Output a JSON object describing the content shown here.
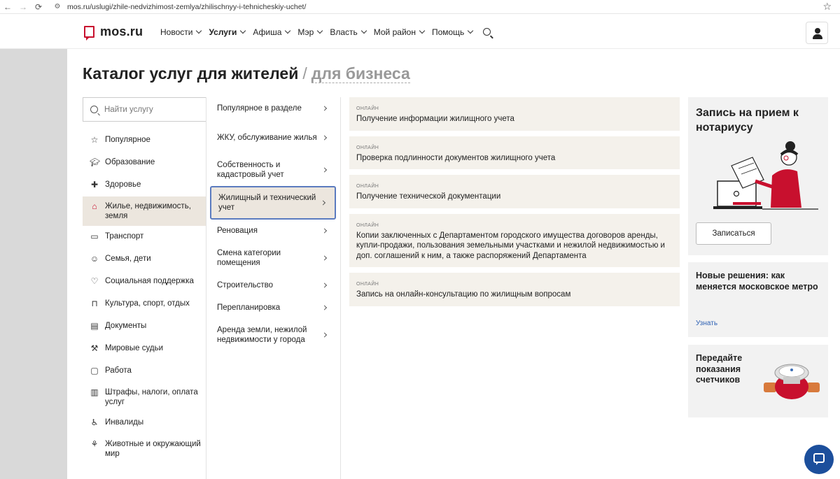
{
  "browser": {
    "back": "←",
    "forward": "→",
    "reload": "C",
    "url": "mos.ru/uslugi/zhile-nedvizhimost-zemlya/zhilischnyy-i-tehnicheskiy-uchet/"
  },
  "header": {
    "logo": "mos.ru",
    "menu": [
      {
        "label": "Новости",
        "active": false
      },
      {
        "label": "Услуги",
        "active": true
      },
      {
        "label": "Афиша",
        "active": false
      },
      {
        "label": "Мэр",
        "active": false
      },
      {
        "label": "Власть",
        "active": false
      },
      {
        "label": "Мой район",
        "active": false
      },
      {
        "label": "Помощь",
        "active": false
      }
    ]
  },
  "page": {
    "title": "Каталог услуг для жителей",
    "separator": "/",
    "alt_title": "для бизнеса"
  },
  "search": {
    "placeholder": "Найти услугу"
  },
  "categories": [
    {
      "label": "Популярное",
      "icon": "star-icon",
      "glyph": "☆"
    },
    {
      "label": "Образование",
      "icon": "graduation-cap-icon",
      "glyph": "⌂"
    },
    {
      "label": "Здоровье",
      "icon": "health-cross-icon",
      "glyph": "✚"
    },
    {
      "label": "Жилье, недвижимость, земля",
      "icon": "house-icon",
      "glyph": "⌂",
      "active": true
    },
    {
      "label": "Транспорт",
      "icon": "bus-icon",
      "glyph": "▭"
    },
    {
      "label": "Семья, дети",
      "icon": "family-icon",
      "glyph": "☺"
    },
    {
      "label": "Социальная поддержка",
      "icon": "heart-icon",
      "glyph": "♡"
    },
    {
      "label": "Культура, спорт, отдых",
      "icon": "museum-icon",
      "glyph": "⊓"
    },
    {
      "label": "Документы",
      "icon": "document-icon",
      "glyph": "▤"
    },
    {
      "label": "Мировые судьи",
      "icon": "gavel-icon",
      "glyph": "⚒"
    },
    {
      "label": "Работа",
      "icon": "briefcase-icon",
      "glyph": "▢"
    },
    {
      "label": "Штрафы, налоги, оплата услуг",
      "icon": "receipt-icon",
      "glyph": "▥"
    },
    {
      "label": "Инвалиды",
      "icon": "wheelchair-icon",
      "glyph": "♿"
    },
    {
      "label": "Животные и окружающий мир",
      "icon": "plant-icon",
      "glyph": "⚘"
    }
  ],
  "subcategories": [
    {
      "label": "Популярное в разделе"
    },
    {
      "label": "ЖКУ, обслуживание жилья"
    },
    {
      "label": "Собственность и кадастровый учет"
    },
    {
      "label": "Жилищный и технический учет",
      "active": true
    },
    {
      "label": "Реновация"
    },
    {
      "label": "Смена категории помещения"
    },
    {
      "label": "Строительство"
    },
    {
      "label": "Перепланировка"
    },
    {
      "label": "Аренда земли, нежилой недвижимости у города"
    }
  ],
  "services": [
    {
      "tag": "онлайн",
      "name": "Получение информации жилищного учета"
    },
    {
      "tag": "онлайн",
      "name": "Проверка подлинности документов жилищного учета"
    },
    {
      "tag": "онлайн",
      "name": "Получение технической документации"
    },
    {
      "tag": "онлайн",
      "name": "Копии заключенных с Департаментом городского имущества договоров аренды, купли-продажи, пользования земельными участками и нежилой недвижимостью и доп. соглашений к ним, а также распоряжений Департамента"
    },
    {
      "tag": "онлайн",
      "name": "Запись на онлайн-консультацию по жилищным вопросам"
    }
  ],
  "promos": {
    "notary": {
      "title": "Запись на прием к нотариусу",
      "button": "Записаться"
    },
    "metro": {
      "title": "Новые решения: как меняется московское метро",
      "link": "Узнать"
    },
    "meters": {
      "title": "Передайте показания счетчиков"
    }
  },
  "colors": {
    "brand_red": "#c8102e",
    "accent_blue": "#1c4f9c",
    "active_bg": "#ece6de"
  }
}
